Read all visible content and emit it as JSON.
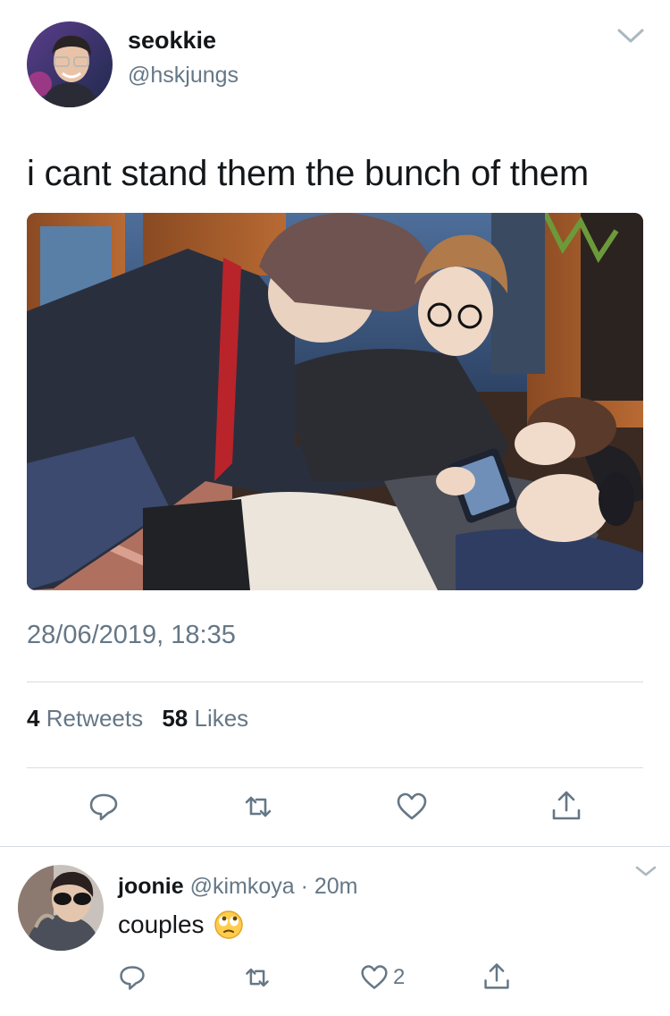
{
  "tweet": {
    "display_name": "seokkie",
    "handle": "@hskjungs",
    "text": "i cant stand them the bunch of them",
    "timestamp": "28/06/2019, 18:35",
    "retweets_count": "4",
    "retweets_label": "Retweets",
    "likes_count": "58",
    "likes_label": "Likes"
  },
  "reply": {
    "display_name": "joonie",
    "handle": "@kimkoya",
    "separator": "·",
    "time": "20m",
    "text": "couples",
    "emoji": "face-with-rolling-eyes",
    "like_count": "2"
  },
  "icons": {
    "reply": "reply-icon",
    "retweet": "retweet-icon",
    "like": "heart-icon",
    "share": "share-icon",
    "menu": "chevron-down-icon"
  },
  "colors": {
    "text_primary": "#14171a",
    "text_secondary": "#657786",
    "divider": "#d6dde3"
  }
}
